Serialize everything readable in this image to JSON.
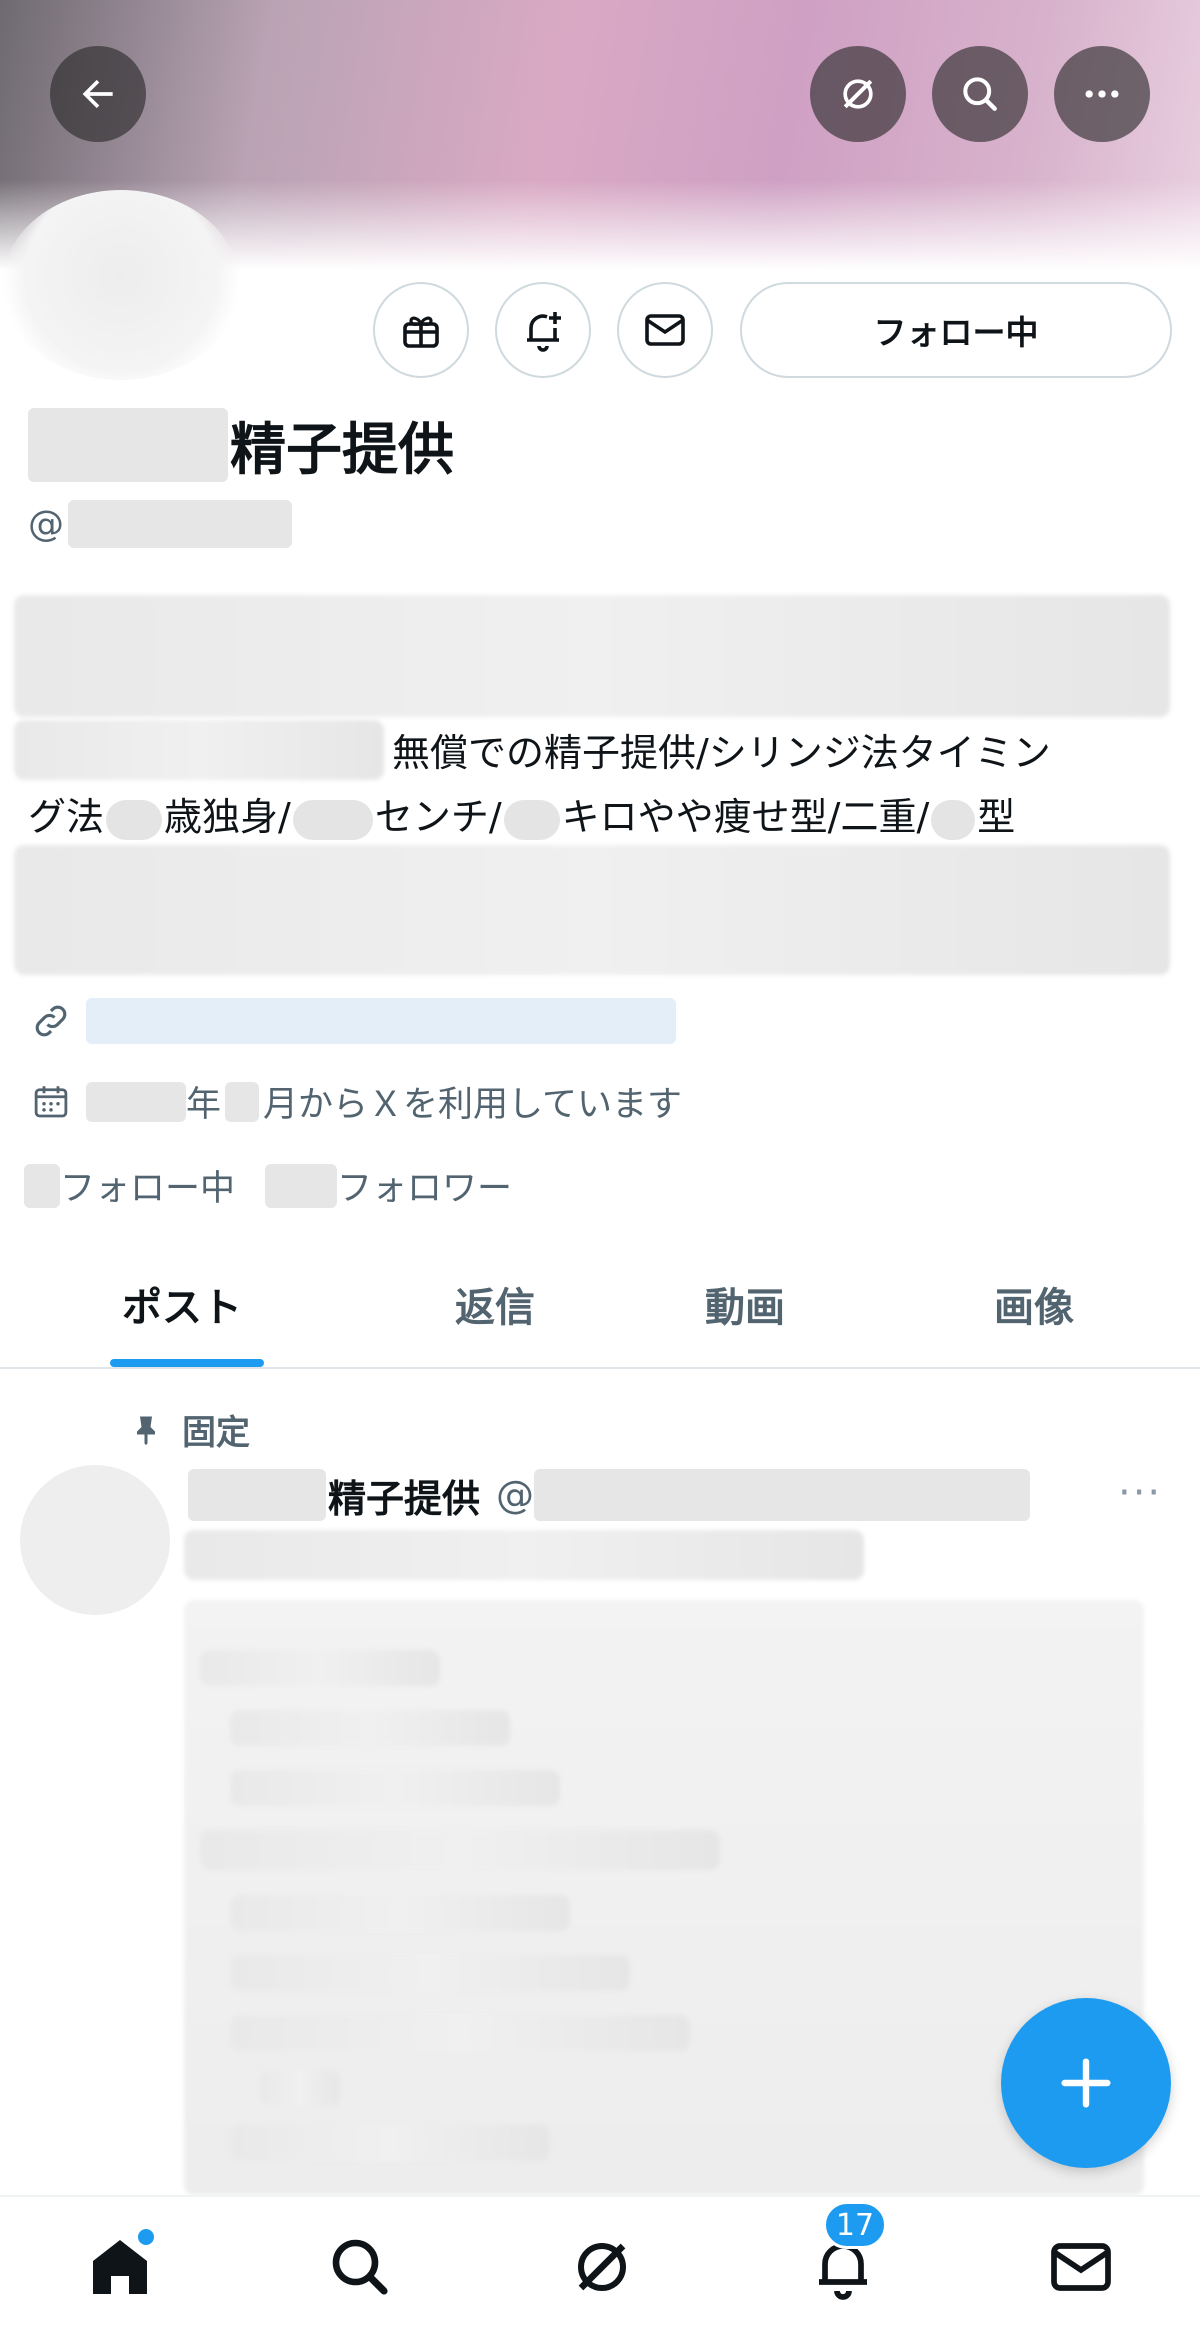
{
  "header": {
    "back_icon": "arrow-left-icon",
    "grok_icon": "grok-icon",
    "search_icon": "search-icon",
    "more_icon": "more-horizontal-icon"
  },
  "profile": {
    "follow_button_label": "フォロー中",
    "name_suffix": "精子提供",
    "handle_prefix": "@",
    "bio": {
      "line1": "無償での精子提供/シリンジ法タイミン",
      "line2_a": "グ法",
      "line2_b": "歳独身/",
      "line2_c": "センチ/",
      "line2_d": "キロやや痩せ型/二重/",
      "line2_e": "型"
    },
    "joined_year_suffix": "年",
    "joined_text": "月からＸを利用しています",
    "following_label": "フォロー中",
    "followers_label": "フォロワー"
  },
  "tabs": [
    {
      "label": "ポスト",
      "active": true
    },
    {
      "label": "返信",
      "active": false
    },
    {
      "label": "動画",
      "active": false
    },
    {
      "label": "画像",
      "active": false
    }
  ],
  "pinned_post": {
    "pinned_label": "固定",
    "author_name_suffix": "精子提供",
    "author_handle_prefix": "@",
    "more_label": "···"
  },
  "bottom_nav": {
    "items": [
      "home-icon",
      "search-icon",
      "grok-icon",
      "notifications-icon",
      "messages-icon"
    ],
    "notifications_count": "17"
  },
  "colors": {
    "accent": "#1d9bf0",
    "text_primary": "#0f1419",
    "text_secondary": "#536471"
  }
}
